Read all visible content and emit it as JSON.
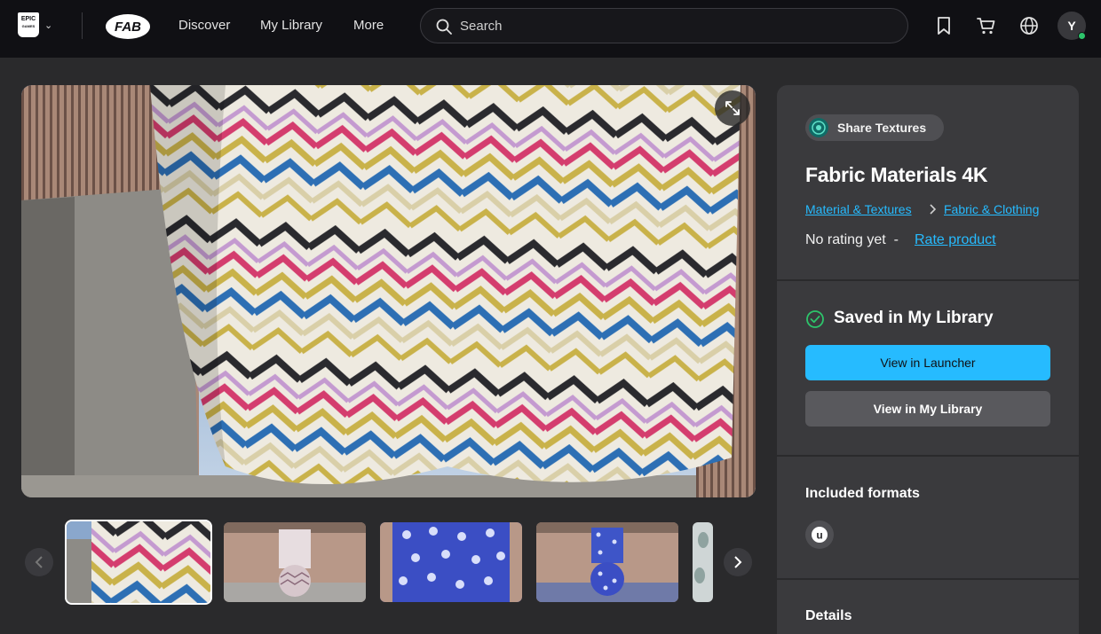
{
  "topbar": {
    "epic_logo_text": "EPIC GAMES",
    "fab_logo_text": "FAB",
    "nav": [
      "Discover",
      "My Library",
      "More"
    ],
    "search_placeholder": "Search",
    "avatar_initial": "Y"
  },
  "seller": {
    "name": "Share Textures"
  },
  "product": {
    "title": "Fabric Materials 4K",
    "breadcrumbs": [
      "Material & Textures",
      "Fabric & Clothing"
    ],
    "rating_text": "No rating yet",
    "rating_separator": "-",
    "rate_link": "Rate product"
  },
  "library": {
    "saved_text": "Saved in My Library",
    "view_launcher": "View in Launcher",
    "view_library": "View in My Library"
  },
  "formats": {
    "title": "Included formats",
    "items": [
      "unreal-engine-icon"
    ]
  },
  "details": {
    "title": "Details"
  },
  "colors": {
    "accent": "#26bbff",
    "topbar": "#101014",
    "panel": "#3a3a3d",
    "online": "#2dc46b",
    "saved_check": "#2dc46b"
  }
}
